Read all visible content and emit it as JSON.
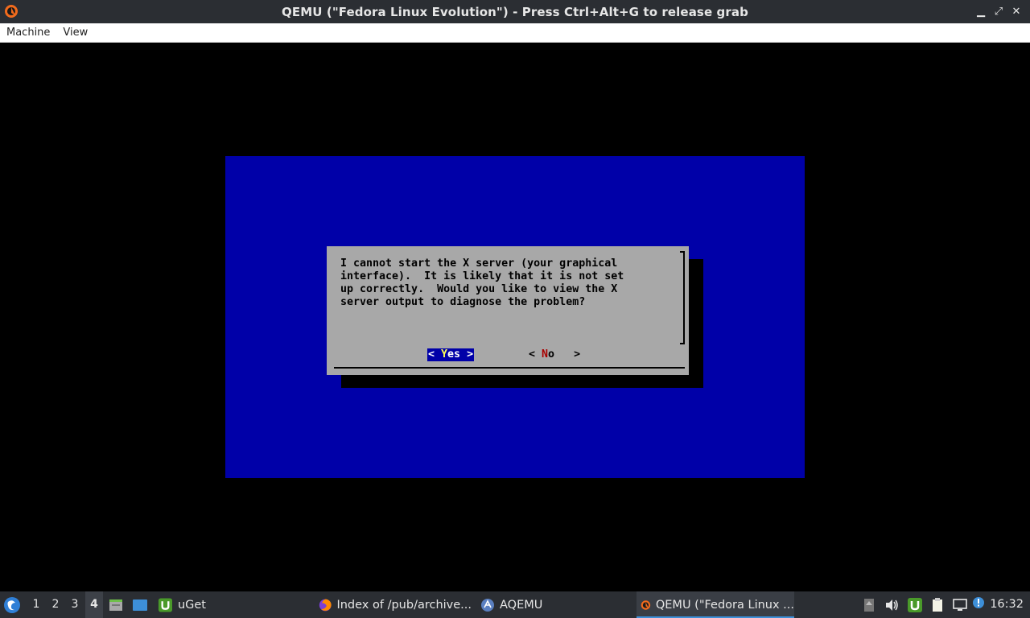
{
  "window": {
    "title": "QEMU (\"Fedora Linux Evolution\") - Press Ctrl+Alt+G to release grab",
    "controls": {
      "minimize": "▁",
      "maximize": "⤢",
      "close": "✕"
    }
  },
  "menubar": {
    "items": [
      {
        "label": "Machine"
      },
      {
        "label": "View"
      }
    ]
  },
  "guest": {
    "colors": {
      "background": "#000000",
      "screen": "#0000a8",
      "dialog": "#a8a8a8"
    },
    "dialog": {
      "message": "I cannot start the X server (your graphical\ninterface).  It is likely that it is not set\nup correctly.  Would you like to view the X\nserver output to diagnose the problem?",
      "yes_button": {
        "left": "<",
        "hotkey": "Y",
        "rest": "es",
        "right": ">",
        "selected": true
      },
      "no_button": {
        "left": "<",
        "hotkey": "N",
        "rest": "o",
        "right": ">",
        "selected": false
      }
    }
  },
  "taskbar": {
    "workspaces": [
      "1",
      "2",
      "3",
      "4"
    ],
    "active_workspace": "4",
    "launchers": [
      "file-manager-icon",
      "desktop-icon"
    ],
    "tasks": [
      {
        "label": "uGet",
        "icon": "uget-icon",
        "active": false
      },
      {
        "label": "Index of /pub/archive...",
        "icon": "firefox-icon",
        "active": false
      },
      {
        "label": "AQEMU",
        "icon": "aqemu-icon",
        "active": false
      },
      {
        "label": "QEMU (\"Fedora Linux ...",
        "icon": "qemu-icon",
        "active": true
      }
    ],
    "tray": [
      "volume-icon",
      "uget-tray-icon",
      "clipboard-icon",
      "network-icon",
      "updates-icon"
    ],
    "clock": "16:32"
  }
}
